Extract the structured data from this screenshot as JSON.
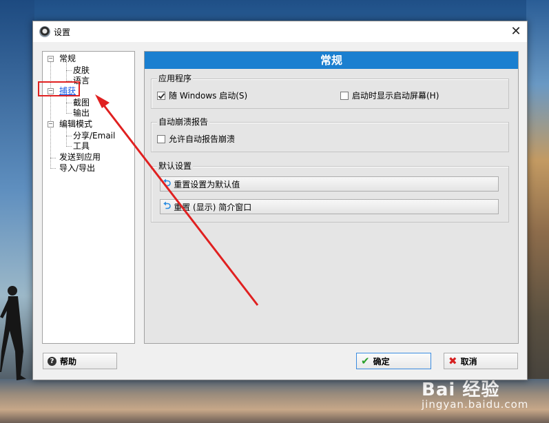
{
  "window": {
    "title": "设置",
    "close_glyph": "✕"
  },
  "tree": {
    "items": [
      {
        "label": "常规",
        "toggle": "−"
      },
      {
        "label": "皮肤"
      },
      {
        "label": "语言"
      },
      {
        "label": "捕获",
        "toggle": "−",
        "selected": true
      },
      {
        "label": "截图"
      },
      {
        "label": "输出"
      },
      {
        "label": "编辑模式",
        "toggle": "−"
      },
      {
        "label": "分享/Email"
      },
      {
        "label": "工具"
      },
      {
        "label": "发送到应用"
      },
      {
        "label": "导入/导出"
      }
    ]
  },
  "panel": {
    "header": "常规",
    "app_group": {
      "title": "应用程序",
      "options": [
        {
          "label": "随 Windows 启动(S)",
          "checked": true
        },
        {
          "label": "启动时显示启动屏幕(H)",
          "checked": false
        }
      ]
    },
    "crash_group": {
      "title": "自动崩溃报告",
      "options": [
        {
          "label": "允许自动报告崩溃",
          "checked": false
        }
      ]
    },
    "defaults_group": {
      "title": "默认设置",
      "buttons": [
        {
          "label": "重置设置为默认值"
        },
        {
          "label": "重置 (显示) 简介窗口"
        }
      ]
    }
  },
  "footer": {
    "help_label": "帮助",
    "ok_label": "确定",
    "cancel_label": "取消"
  },
  "watermark": {
    "logo": "Bai 经验",
    "url": "jingyan.baidu.com"
  },
  "colors": {
    "header_bg": "#1a7fd0",
    "annotation": "#e02020",
    "link": "#1a5ce6"
  },
  "icons": {
    "help": "question-circle-icon",
    "ok": "checkmark-icon",
    "cancel": "x-mark-icon",
    "reset": "undo-arrow-icon"
  }
}
